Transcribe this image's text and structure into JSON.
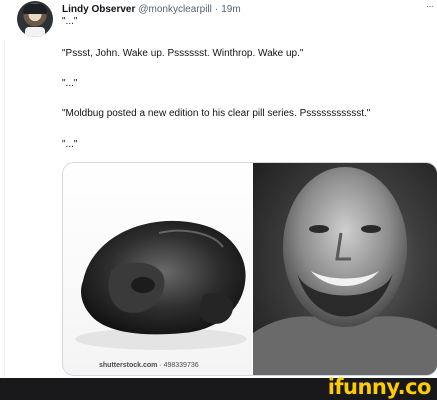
{
  "tweet": {
    "author": {
      "display_name": "Lindy Observer",
      "handle": "@monkyclearpill",
      "separator": "·",
      "time": "19m"
    },
    "more_icon": "more-horizontal-icon",
    "lines": [
      "\"...\"",
      "\"Pssst, John. Wake up. Psssssst. Winthrop. Wake up.\"",
      "\"...\"",
      "\"Moldbug posted a new edition to his clear pill series. Pssssssssssst.\"",
      "\"...\""
    ],
    "media": {
      "watermark_brand": "shutterstock.com",
      "watermark_separator": " · ",
      "watermark_id": "498339736"
    }
  },
  "footer": {
    "brand": "ifunny.co",
    "brand_color": "#ffcc00"
  }
}
